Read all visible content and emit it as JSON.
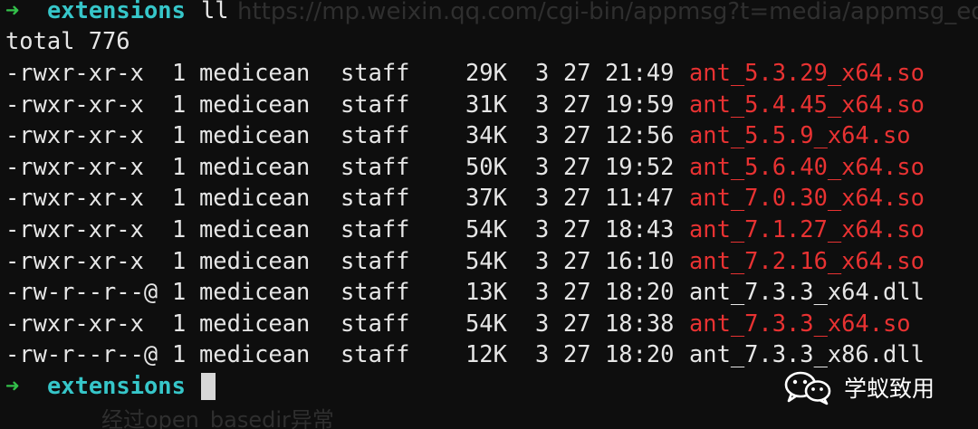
{
  "prompt": {
    "arrow": "➜",
    "directory": "extensions",
    "command": "ll"
  },
  "total_line": "total 776",
  "listing": [
    {
      "perms": "-rwxr-xr-x",
      "links": "1",
      "owner": "medicean",
      "group": "staff",
      "size": "29K",
      "month": "3",
      "day": "27",
      "time": "21:49",
      "name": "ant_5.3.29_x64.so",
      "exec": true
    },
    {
      "perms": "-rwxr-xr-x",
      "links": "1",
      "owner": "medicean",
      "group": "staff",
      "size": "31K",
      "month": "3",
      "day": "27",
      "time": "19:59",
      "name": "ant_5.4.45_x64.so",
      "exec": true
    },
    {
      "perms": "-rwxr-xr-x",
      "links": "1",
      "owner": "medicean",
      "group": "staff",
      "size": "34K",
      "month": "3",
      "day": "27",
      "time": "12:56",
      "name": "ant_5.5.9_x64.so",
      "exec": true
    },
    {
      "perms": "-rwxr-xr-x",
      "links": "1",
      "owner": "medicean",
      "group": "staff",
      "size": "50K",
      "month": "3",
      "day": "27",
      "time": "19:52",
      "name": "ant_5.6.40_x64.so",
      "exec": true
    },
    {
      "perms": "-rwxr-xr-x",
      "links": "1",
      "owner": "medicean",
      "group": "staff",
      "size": "37K",
      "month": "3",
      "day": "27",
      "time": "11:47",
      "name": "ant_7.0.30_x64.so",
      "exec": true
    },
    {
      "perms": "-rwxr-xr-x",
      "links": "1",
      "owner": "medicean",
      "group": "staff",
      "size": "54K",
      "month": "3",
      "day": "27",
      "time": "18:43",
      "name": "ant_7.1.27_x64.so",
      "exec": true
    },
    {
      "perms": "-rwxr-xr-x",
      "links": "1",
      "owner": "medicean",
      "group": "staff",
      "size": "54K",
      "month": "3",
      "day": "27",
      "time": "16:10",
      "name": "ant_7.2.16_x64.so",
      "exec": true
    },
    {
      "perms": "-rw-r--r--@",
      "links": "1",
      "owner": "medicean",
      "group": "staff",
      "size": "13K",
      "month": "3",
      "day": "27",
      "time": "18:20",
      "name": "ant_7.3.3_x64.dll",
      "exec": false
    },
    {
      "perms": "-rwxr-xr-x",
      "links": "1",
      "owner": "medicean",
      "group": "staff",
      "size": "54K",
      "month": "3",
      "day": "27",
      "time": "18:38",
      "name": "ant_7.3.3_x64.so",
      "exec": true
    },
    {
      "perms": "-rw-r--r--@",
      "links": "1",
      "owner": "medicean",
      "group": "staff",
      "size": "12K",
      "month": "3",
      "day": "27",
      "time": "18:20",
      "name": "ant_7.3.3_x86.dll",
      "exec": false
    }
  ],
  "background_ghost": {
    "url_text": "https://mp.weixin.qq.com/cgi-bin/appmsg?t=media/appmsg_edi",
    "bottom_text": "经过open_basedir异常"
  },
  "watermark": {
    "text": "学蚁致用",
    "icon": "wechat-icon"
  },
  "colors": {
    "background": "#0e0e0e",
    "text": "#e6e6e6",
    "prompt_arrow": "#33c04a",
    "prompt_dir": "#36c6c9",
    "executable": "#e83232"
  }
}
